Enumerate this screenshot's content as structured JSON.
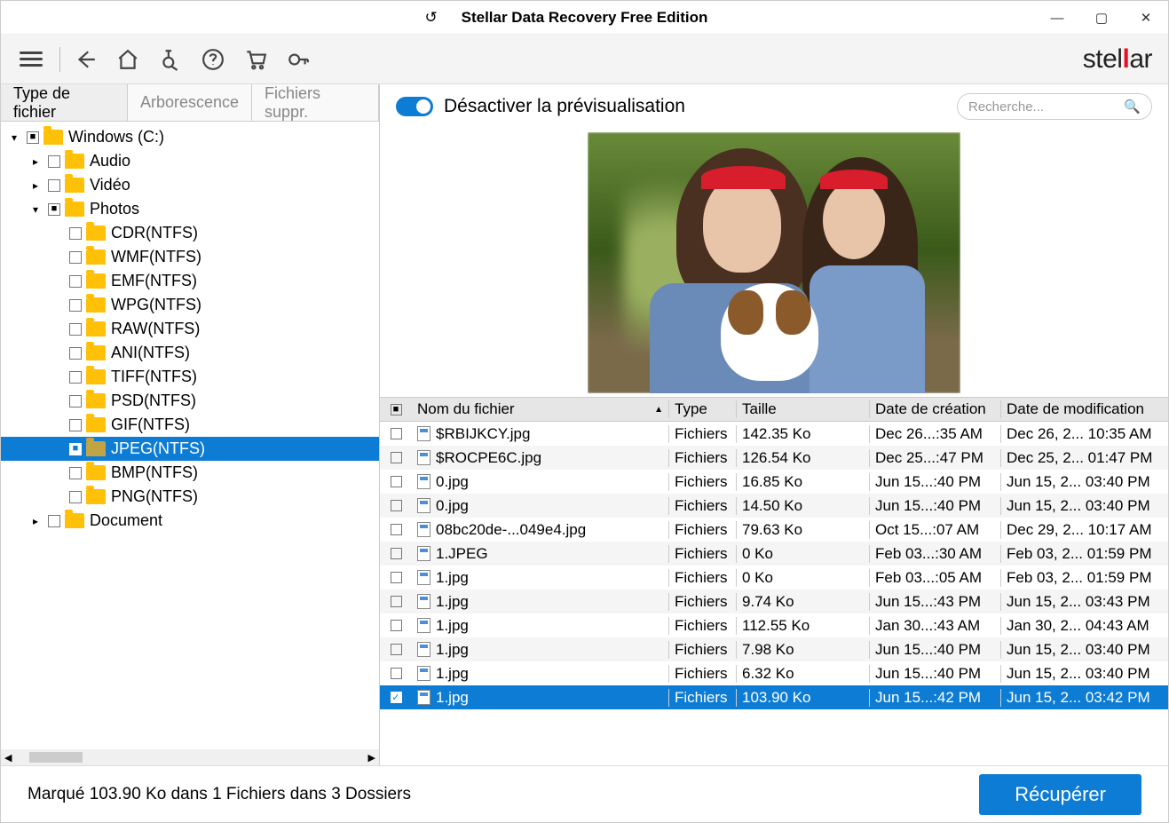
{
  "titlebar": {
    "title": "Stellar Data Recovery Free Edition"
  },
  "logo": {
    "text_pre": "stel",
    "text_mid": "l",
    "text_post": "ar"
  },
  "tabs": {
    "file_type": "Type de fichier",
    "tree_view": "Arborescence",
    "deleted": "Fichiers suppr."
  },
  "tree": {
    "root": "Windows (C:)",
    "children": [
      {
        "label": "Audio",
        "expandable": true,
        "level": 1
      },
      {
        "label": "Vidéo",
        "expandable": true,
        "level": 1
      },
      {
        "label": "Photos",
        "expandable": true,
        "expanded": true,
        "level": 1,
        "children": [
          "CDR(NTFS)",
          "WMF(NTFS)",
          "EMF(NTFS)",
          "WPG(NTFS)",
          "RAW(NTFS)",
          "ANI(NTFS)",
          "TIFF(NTFS)",
          "PSD(NTFS)",
          "GIF(NTFS)",
          "JPEG(NTFS)",
          "BMP(NTFS)",
          "PNG(NTFS)"
        ]
      },
      {
        "label": "Document",
        "expandable": true,
        "level": 1
      }
    ],
    "selected": "JPEG(NTFS)"
  },
  "preview": {
    "toggle_label": "Désactiver la prévisualisation",
    "search_placeholder": "Recherche..."
  },
  "table": {
    "headers": {
      "filename": "Nom du fichier",
      "type": "Type",
      "size": "Taille",
      "created": "Date de création",
      "modified": "Date de modification"
    },
    "rows": [
      {
        "name": "$RBIJKCY.jpg",
        "type": "Fichiers",
        "size": "142.35 Ko",
        "created": "Dec 26...:35 AM",
        "modified": "Dec 26, 2... 10:35 AM"
      },
      {
        "name": "$ROCPE6C.jpg",
        "type": "Fichiers",
        "size": "126.54 Ko",
        "created": "Dec 25...:47 PM",
        "modified": "Dec 25, 2... 01:47 PM"
      },
      {
        "name": "0.jpg",
        "type": "Fichiers",
        "size": "16.85 Ko",
        "created": "Jun 15...:40 PM",
        "modified": "Jun 15, 2... 03:40 PM"
      },
      {
        "name": "0.jpg",
        "type": "Fichiers",
        "size": "14.50 Ko",
        "created": "Jun 15...:40 PM",
        "modified": "Jun 15, 2... 03:40 PM"
      },
      {
        "name": "08bc20de-...049e4.jpg",
        "type": "Fichiers",
        "size": "79.63 Ko",
        "created": "Oct 15...:07 AM",
        "modified": "Dec 29, 2... 10:17 AM"
      },
      {
        "name": "1.JPEG",
        "type": "Fichiers",
        "size": "0 Ko",
        "created": "Feb 03...:30 AM",
        "modified": "Feb 03, 2... 01:59 PM"
      },
      {
        "name": "1.jpg",
        "type": "Fichiers",
        "size": "0 Ko",
        "created": "Feb 03...:05 AM",
        "modified": "Feb 03, 2... 01:59 PM"
      },
      {
        "name": "1.jpg",
        "type": "Fichiers",
        "size": "9.74 Ko",
        "created": "Jun 15...:43 PM",
        "modified": "Jun 15, 2... 03:43 PM"
      },
      {
        "name": "1.jpg",
        "type": "Fichiers",
        "size": "112.55 Ko",
        "created": "Jan 30...:43 AM",
        "modified": "Jan 30, 2... 04:43 AM"
      },
      {
        "name": "1.jpg",
        "type": "Fichiers",
        "size": "7.98 Ko",
        "created": "Jun 15...:40 PM",
        "modified": "Jun 15, 2... 03:40 PM"
      },
      {
        "name": "1.jpg",
        "type": "Fichiers",
        "size": "6.32 Ko",
        "created": "Jun 15...:40 PM",
        "modified": "Jun 15, 2... 03:40 PM"
      },
      {
        "name": "1.jpg",
        "type": "Fichiers",
        "size": "103.90 Ko",
        "created": "Jun 15...:42 PM",
        "modified": "Jun 15, 2... 03:42 PM",
        "selected": true,
        "checked": true
      }
    ]
  },
  "status": {
    "text": "Marqué 103.90 Ko dans 1 Fichiers dans 3 Dossiers"
  },
  "recover": {
    "label": "Récupérer"
  }
}
